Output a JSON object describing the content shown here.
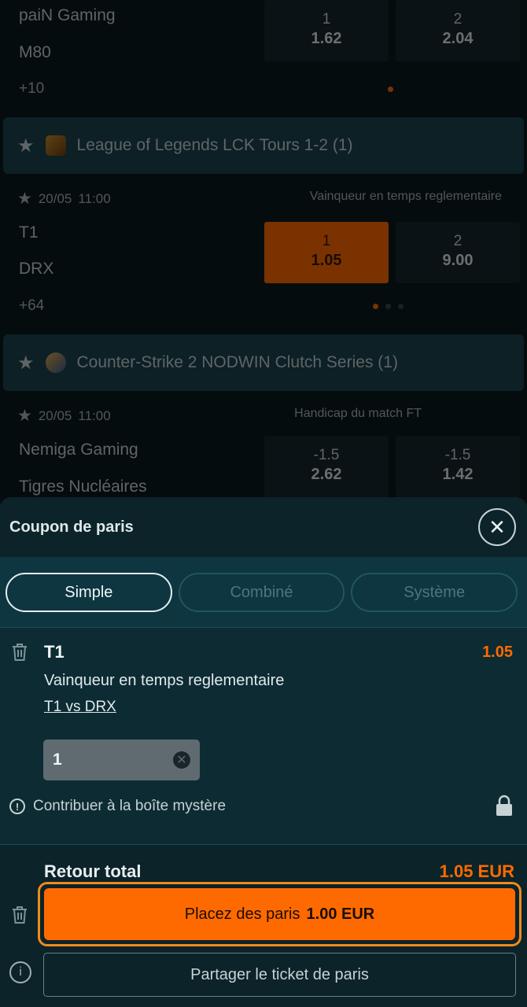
{
  "matches": [
    {
      "team1": "paiN Gaming",
      "team2": "M80",
      "count": "+10",
      "odds": [
        {
          "label": "1",
          "value": "1.62"
        },
        {
          "label": "2",
          "value": "2.04"
        }
      ]
    },
    {
      "date": "20/05",
      "time": "11:00",
      "market": "Vainqueur en temps reglementaire",
      "team1": "T1",
      "team2": "DRX",
      "count": "+64",
      "odds": [
        {
          "label": "1",
          "value": "1.05"
        },
        {
          "label": "2",
          "value": "9.00"
        }
      ]
    },
    {
      "date": "20/05",
      "time": "11:00",
      "market": "Handicap du match FT",
      "team1": "Nemiga Gaming",
      "team2": "Tigres Nucléaires",
      "odds": [
        {
          "label": "-1.5",
          "value": "2.62"
        },
        {
          "label": "-1.5",
          "value": "1.42"
        }
      ]
    }
  ],
  "leagues": [
    {
      "name": "League of Legends LCK Tours 1-2 (1)",
      "icon": "lol-icon"
    },
    {
      "name": "Counter-Strike 2 NODWIN Clutch Series (1)",
      "icon": "cs2-icon"
    }
  ],
  "slip": {
    "title": "Coupon de paris",
    "tabs": [
      "Simple",
      "Combiné",
      "Système"
    ],
    "active_tab": "Simple",
    "bet": {
      "selection": "T1",
      "odds": "1.05",
      "market": "Vainqueur en temps reglementaire",
      "event": "T1 vs DRX",
      "stake": "1"
    },
    "mystery_box": "Contribuer à la boîte mystère",
    "total_return_label": "Retour total",
    "total_return_value": "1.05 EUR",
    "place_label": "Placez des paris",
    "place_amount": "1.00 EUR",
    "share_label": "Partager le ticket de paris"
  },
  "colors": {
    "accent": "#ff6a00",
    "panel": "#0d2b33",
    "league_bar": "#1a444f"
  }
}
